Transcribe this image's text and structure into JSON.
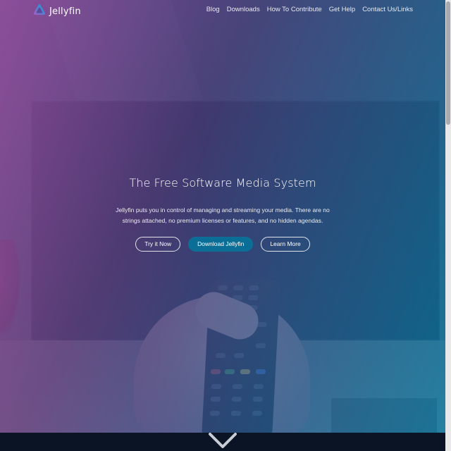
{
  "brand": {
    "name": "Jellyfin",
    "logo_icon": "jellyfin-triangle-logo"
  },
  "nav": {
    "links": [
      "Blog",
      "Downloads",
      "How To Contribute",
      "Get Help",
      "Contact Us/Links"
    ]
  },
  "hero": {
    "title": "The Free Software Media System",
    "description": "Jellyfin puts you in control of managing and streaming your media. There are no strings attached, no premium licenses or features, and no hidden agendas.",
    "buttons": {
      "try": "Try it Now",
      "download": "Download Jellyfin",
      "learn": "Learn More"
    }
  },
  "scroll_icon": "chevron-down-icon",
  "colors": {
    "accent_purple": "#aa5cc3",
    "accent_blue": "#00a4dc",
    "primary_button": "#0b6e96",
    "bottom_strip": "#0a1424"
  }
}
